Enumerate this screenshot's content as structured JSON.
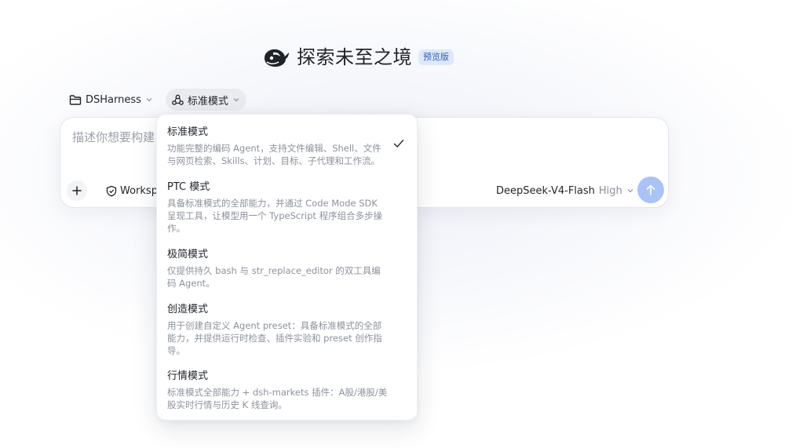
{
  "hero": {
    "title": "探索未至之境",
    "badge": "预览版",
    "logo_icon": "whale-logo-icon"
  },
  "selectors": {
    "project": {
      "label": "DSHarness",
      "icon": "folder-icon"
    },
    "mode": {
      "label": "标准模式",
      "icon": "agent-mode-icon"
    }
  },
  "composer": {
    "placeholder": "描述你想要构建",
    "workspace_label": "Worksp",
    "model": "DeepSeek-V4-Flash",
    "effort": "High",
    "send_color": "#a9c2f7"
  },
  "mode_menu": {
    "selected_index": 0,
    "items": [
      {
        "title": "标准模式",
        "description": "功能完整的编码 Agent，支持文件编辑、Shell、文件与网页检索、Skills、计划、目标、子代理和工作流。"
      },
      {
        "title": "PTC 模式",
        "description": "具备标准模式的全部能力，并通过 Code Mode SDK 呈现工具，让模型用一个 TypeScript 程序组合多步操作。"
      },
      {
        "title": "极简模式",
        "description": "仅提供持久 bash 与 str_replace_editor 的双工具编码 Agent。"
      },
      {
        "title": "创造模式",
        "description": "用于创建自定义 Agent preset：具备标准模式的全部能力，并提供运行时检查、插件实验和 preset 创作指导。"
      },
      {
        "title": "行情模式",
        "description": "标准模式全部能力 + dsh-markets 插件：A股/港股/美股实时行情与历史 K 线查询。"
      }
    ]
  },
  "colors": {
    "accent": "#2f5ec4",
    "badge_bg": "#dfe8f8",
    "text_primary": "#1f2329",
    "text_secondary": "#8c929c"
  }
}
